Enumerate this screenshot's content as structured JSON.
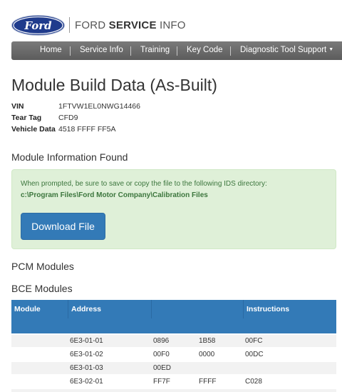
{
  "header": {
    "logo_text": "Ford",
    "brand_prefix": "FORD ",
    "brand_bold": "SERVICE",
    "brand_suffix": " INFO"
  },
  "nav": {
    "items": [
      "Home",
      "Service Info",
      "Training",
      "Key Code",
      "Diagnostic Tool Support"
    ]
  },
  "page_title": "Module Build Data (As-Built)",
  "vehicle": {
    "vin_label": "VIN",
    "vin": "1FTVW1EL0NWG14466",
    "tear_tag_label": "Tear Tag",
    "tear_tag": "CFD9",
    "vehicle_data_label": "Vehicle Data",
    "vehicle_data": "4518 FFFF FF5A"
  },
  "module_info_heading": "Module Information Found",
  "alert": {
    "message": "When prompted, be sure to save or copy the file to the following IDS directory:",
    "path": "c:\\Program Files\\Ford Motor Company\\Calibration Files",
    "download_label": "Download File"
  },
  "pcm_heading": "PCM Modules",
  "bce_heading": "BCE Modules",
  "table": {
    "columns": [
      "Module",
      "Address",
      "",
      "Instructions"
    ],
    "rows": [
      {
        "module": "",
        "address": "6E3-01-01",
        "v1": "0896",
        "v2": "1B58",
        "v3": "00FC"
      },
      {
        "module": "",
        "address": "6E3-01-02",
        "v1": "00F0",
        "v2": "0000",
        "v3": "00DC"
      },
      {
        "module": "",
        "address": "6E3-01-03",
        "v1": "00ED",
        "v2": "",
        "v3": ""
      },
      {
        "module": "",
        "address": "6E3-02-01",
        "v1": "FF7F",
        "v2": "FFFF",
        "v3": "C028"
      }
    ]
  },
  "colors": {
    "primary": "#337ab7",
    "ford_blue": "#1f3b8c",
    "alert_bg": "#dff0d8",
    "alert_text": "#3c763d",
    "nav_bg": "#6b6b6b"
  }
}
